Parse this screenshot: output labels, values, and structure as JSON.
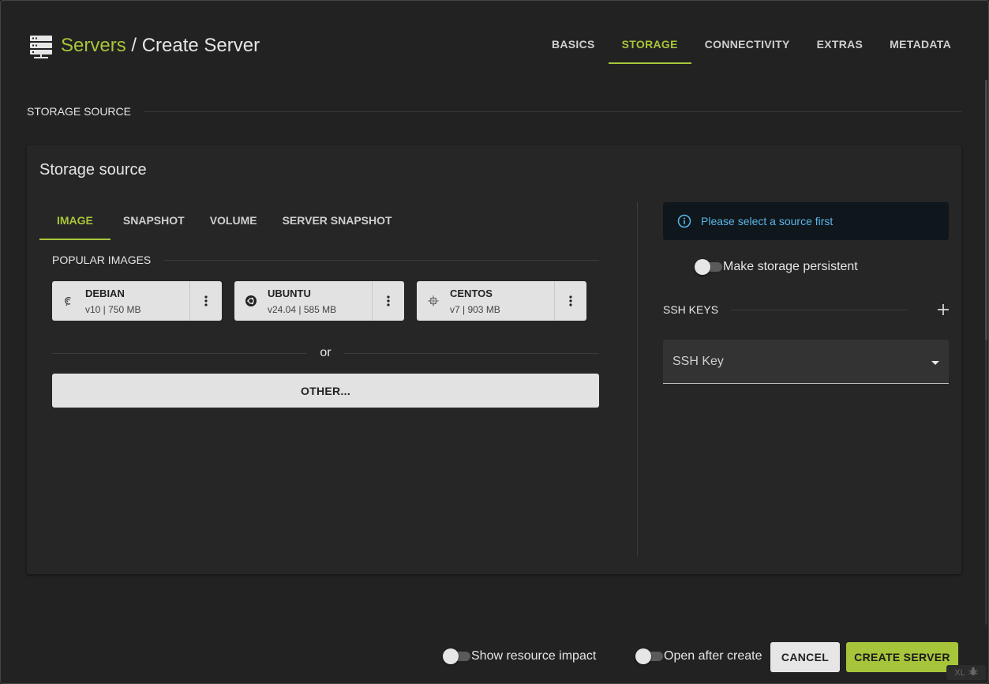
{
  "header": {
    "breadcrumb_parent": "Servers",
    "breadcrumb_separator": " / ",
    "breadcrumb_current": "Create Server",
    "icon": "server-icon"
  },
  "top_tabs": [
    {
      "label": "BASICS",
      "active": false
    },
    {
      "label": "STORAGE",
      "active": true
    },
    {
      "label": "CONNECTIVITY",
      "active": false
    },
    {
      "label": "EXTRAS",
      "active": false
    },
    {
      "label": "METADATA",
      "active": false
    }
  ],
  "section_heading": "STORAGE SOURCE",
  "card": {
    "title": "Storage source",
    "source_tabs": [
      {
        "label": "IMAGE",
        "active": true
      },
      {
        "label": "SNAPSHOT",
        "active": false
      },
      {
        "label": "VOLUME",
        "active": false
      },
      {
        "label": "SERVER SNAPSHOT",
        "active": false
      }
    ],
    "popular_images_heading": "POPULAR IMAGES",
    "images": [
      {
        "name": "DEBIAN",
        "meta": "v10 | 750 MB",
        "icon": "debian-logo-icon"
      },
      {
        "name": "UBUNTU",
        "meta": "v24.04 | 585 MB",
        "icon": "ubuntu-logo-icon"
      },
      {
        "name": "CENTOS",
        "meta": "v7 | 903 MB",
        "icon": "centos-logo-icon"
      }
    ],
    "or_label": "or",
    "other_button": "OTHER...",
    "info_message": "Please select a source first",
    "persistent_label": "Make storage persistent",
    "persistent_on": false,
    "ssh_keys_heading": "SSH KEYS",
    "ssh_key_select_placeholder": "SSH Key"
  },
  "footer": {
    "show_resource_impact_label": "Show resource impact",
    "show_resource_impact_on": false,
    "open_after_create_label": "Open after create",
    "open_after_create_on": false,
    "cancel_button": "CANCEL",
    "create_button": "CREATE SERVER",
    "badge": "XL"
  },
  "colors": {
    "accent": "#a7c53a",
    "background": "#222222",
    "card": "#262626",
    "info_text": "#5bb6e9"
  }
}
